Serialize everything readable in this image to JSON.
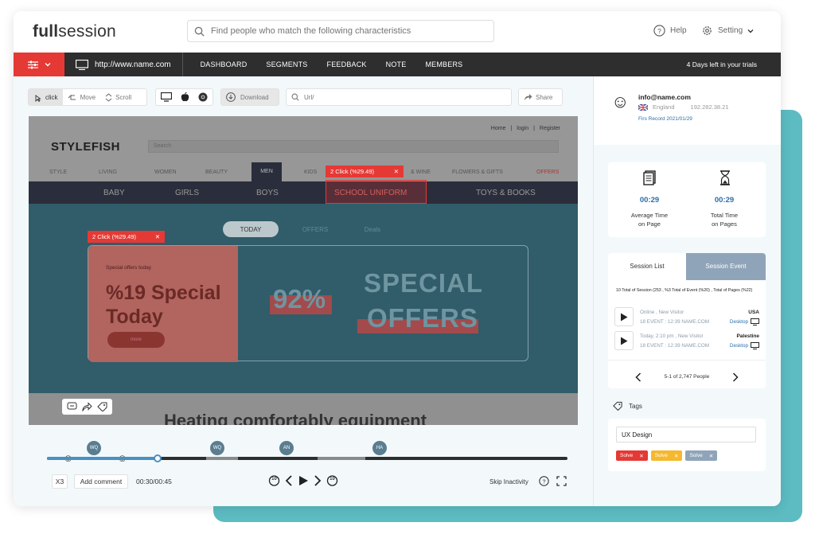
{
  "app": {
    "logo_bold": "full",
    "logo_rest": "session"
  },
  "header": {
    "search_placeholder": "Find people who match the following characteristics",
    "help": "Help",
    "setting": "Setting"
  },
  "nav": {
    "url": "http://www.name.com",
    "links": [
      "DASHBOARD",
      "SEGMENTS",
      "FEEDBACK",
      "NOTE",
      "MEMBERS"
    ],
    "trial": "4 Days left in your trials"
  },
  "toolbar": {
    "click": "click",
    "move": "Move",
    "scroll": "Scroll",
    "download": "Download",
    "url_placeholder": "Url/",
    "share": "Share"
  },
  "replay": {
    "top_links": [
      "Home",
      "|",
      "login",
      "|",
      "Register"
    ],
    "site_logo": "STYLEFISH",
    "site_search": "Search",
    "categories": [
      "STYLE",
      "LIVING",
      "WOMEN",
      "BEAUTY",
      "MEN",
      "KIDS",
      "& WINE",
      "FLOWERS & GIFTS",
      "OFFERS"
    ],
    "subcats": [
      "BABY",
      "GIRLS",
      "BOYS",
      "SCHOOL UNIFORM",
      "TOYS & BOOKS"
    ],
    "click_label_1": "2 Click (%29.49)",
    "click_label_2": "2 Click (%29.49)",
    "tabs": [
      "TODAY",
      "OFFERS",
      "Deals"
    ],
    "promo_small": "Special offers today",
    "promo_title_1": "%19 Special",
    "promo_title_2": "Today",
    "promo_btn": "more",
    "promo_pct": "92%",
    "promo_special": "SPECIAL",
    "promo_offers": "OFFERS",
    "bottom_text": "Heating comfortably equipment"
  },
  "timeline": {
    "markers": [
      "WQ",
      "WQ",
      "AN",
      "HA"
    ],
    "speed": "X3",
    "add_comment": "Add comment",
    "time": "00:30/00:45",
    "skip": "Skip Inactivity",
    "skip_back": "10",
    "skip_fwd": "10"
  },
  "profile": {
    "email": "info@name.com",
    "country": "England",
    "ip": "192.282.38.21",
    "first_record": "Firs Record 2021/01/29"
  },
  "stats": {
    "avg_time": "00:29",
    "avg_label_1": "Average Time",
    "avg_label_2": "on Page",
    "total_time": "00:29",
    "total_label_1": "Total Time",
    "total_label_2": "on Pages"
  },
  "sessions": {
    "tab_list": "Session List",
    "tab_event": "Session Event",
    "summary": "10 Total of Session (253 , %3 Total of Event (%20) , Total of Pages (%22)",
    "rows": [
      {
        "title": "Online , New Visitor",
        "meta": "18 EVENT : 12:39 NAME.COM",
        "country": "USA",
        "device": "Desktop"
      },
      {
        "title": "Today, 2:10 pm , New Visitor",
        "meta": "18 EVENT : 12:39 NAME.COM",
        "country": "Palestine",
        "device": "Desktop"
      }
    ],
    "pagination": "5-1 of 2,747 People"
  },
  "tags": {
    "label": "Tags",
    "input": "UX Design",
    "chips": [
      "Solve",
      "Solve",
      "Solve"
    ],
    "chip_colors": [
      "#e53935",
      "#f5b82e",
      "#8fa4b8"
    ]
  }
}
